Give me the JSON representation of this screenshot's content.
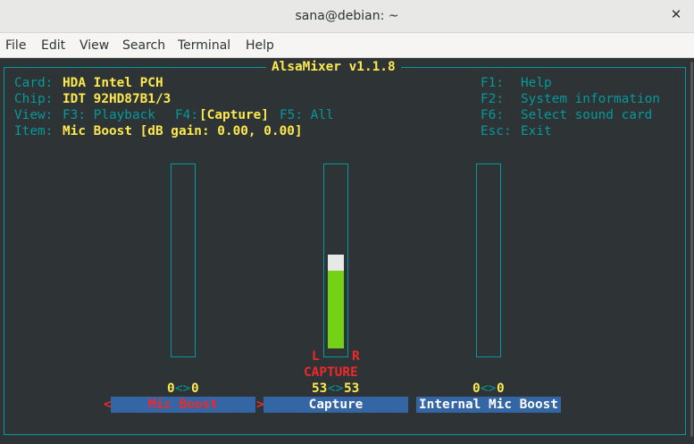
{
  "window": {
    "title": "sana@debian: ~",
    "close_icon": "close-icon"
  },
  "menubar": [
    "File",
    "Edit",
    "View",
    "Search",
    "Terminal",
    "Help"
  ],
  "alsamixer": {
    "title": "AlsaMixer v1.1.8",
    "info": {
      "card_label": "Card:",
      "card_value": "HDA Intel PCH",
      "chip_label": "Chip:",
      "chip_value": "IDT 92HD87B1/3",
      "view_label": "View:",
      "view_f3": "F3: Playback",
      "view_f4_key": "F4:",
      "view_f4_value": "[Capture]",
      "view_f5": "F5: All",
      "item_label": "Item:",
      "item_value": "Mic Boost [dB gain: 0.00, 0.00]"
    },
    "shortcuts": [
      {
        "key": "F1:",
        "action": "Help"
      },
      {
        "key": "F2:",
        "action": "System information"
      },
      {
        "key": "F6:",
        "action": "Select sound card"
      },
      {
        "key": "Esc:",
        "action": "Exit"
      }
    ],
    "channels": [
      {
        "name": "Mic Boost",
        "left_value": "0",
        "right_value": "0",
        "level_fraction": 0,
        "selected": true
      },
      {
        "name": "Capture",
        "left_value": "53",
        "right_value": "53",
        "level_fraction": 0.53,
        "selected": false,
        "capture_left": "L",
        "capture_right": "R",
        "capture_label": "CAPTURE"
      },
      {
        "name": "Internal Mic Boost",
        "left_value": "0",
        "right_value": "0",
        "level_fraction": 0,
        "selected": false
      }
    ],
    "value_separator": "<>",
    "select_left_marker": "<",
    "select_right_marker": ">"
  },
  "colors": {
    "terminal_bg": "#2e3436",
    "border_cyan": "#06989a",
    "value_yellow": "#fce94f",
    "selected_red": "#ef2929",
    "meter_green": "#73d216",
    "label_blue": "#3465a4"
  }
}
